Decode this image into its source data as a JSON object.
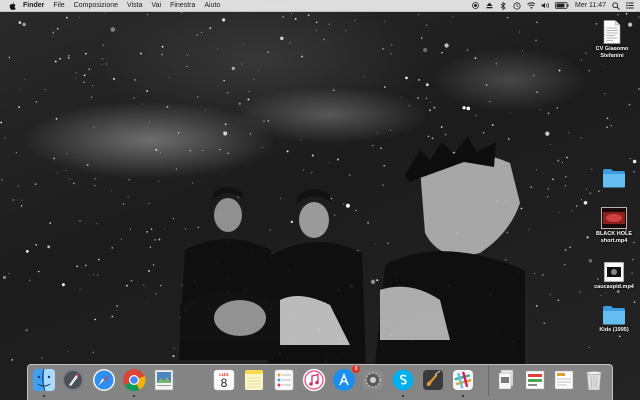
{
  "menubar": {
    "app_name": "Finder",
    "menus": [
      "File",
      "Composizione",
      "Vista",
      "Vai",
      "Finestra",
      "Aiuto"
    ],
    "clock": "Mer 11:47",
    "status_icons": [
      "record-icon",
      "eject-icon",
      "bluetooth-icon",
      "time-machine-icon",
      "wifi-icon",
      "volume-icon",
      "battery-icon",
      "spotlight-icon",
      "notification-center-icon"
    ]
  },
  "desktop": {
    "items": [
      {
        "label": "CV Giacomo Stefanini",
        "lines": [
          "CV Giacomo",
          "Stefanini"
        ],
        "type": "document"
      },
      {
        "label": "",
        "lines": [],
        "type": "folder"
      },
      {
        "label": "BLACK HOLE short.mp4",
        "lines": [
          "BLACK HOLE",
          "short.mp4"
        ],
        "type": "video"
      },
      {
        "label": "caucaspid.mp4",
        "lines": [
          "caucaspid.mp4"
        ],
        "type": "video"
      },
      {
        "label": "Kids (1995)",
        "lines": [
          "Kids (1995)"
        ],
        "type": "folder"
      }
    ]
  },
  "dock": {
    "apps": [
      {
        "name": "Finder",
        "icon": "finder-icon",
        "running": true
      },
      {
        "name": "Launchpad",
        "icon": "launchpad-icon",
        "running": false
      },
      {
        "name": "Safari",
        "icon": "safari-icon",
        "running": false
      },
      {
        "name": "Chrome",
        "icon": "chrome-icon",
        "running": true
      },
      {
        "name": "Preview",
        "icon": "preview-icon",
        "running": false
      },
      {
        "name": "Calendar",
        "icon": "calendar-icon",
        "running": false,
        "month": "LUG",
        "day": "8"
      },
      {
        "name": "Notes",
        "icon": "notes-icon",
        "running": false
      },
      {
        "name": "Reminders",
        "icon": "reminders-icon",
        "running": false
      },
      {
        "name": "iTunes",
        "icon": "itunes-icon",
        "running": false
      },
      {
        "name": "App Store",
        "icon": "app-store-icon",
        "running": false,
        "badge": "3"
      },
      {
        "name": "System Preferences",
        "icon": "system-preferences-icon",
        "running": false
      },
      {
        "name": "Skype",
        "icon": "skype-icon",
        "running": true
      },
      {
        "name": "GarageBand",
        "icon": "garageband-icon",
        "running": false
      },
      {
        "name": "Slack",
        "icon": "slack-icon",
        "running": true
      }
    ],
    "stacks": [
      {
        "name": "Documents",
        "icon": "documents-stack-icon"
      },
      {
        "name": "Downloads",
        "icon": "downloads-stack-icon"
      },
      {
        "name": "Recent",
        "icon": "recent-stack-icon"
      },
      {
        "name": "Trash",
        "icon": "trash-icon"
      }
    ]
  },
  "colors": {
    "menubar_bg": "#ececec",
    "folder_blue": "#5bb5ee",
    "badge_red": "#e0302a"
  }
}
